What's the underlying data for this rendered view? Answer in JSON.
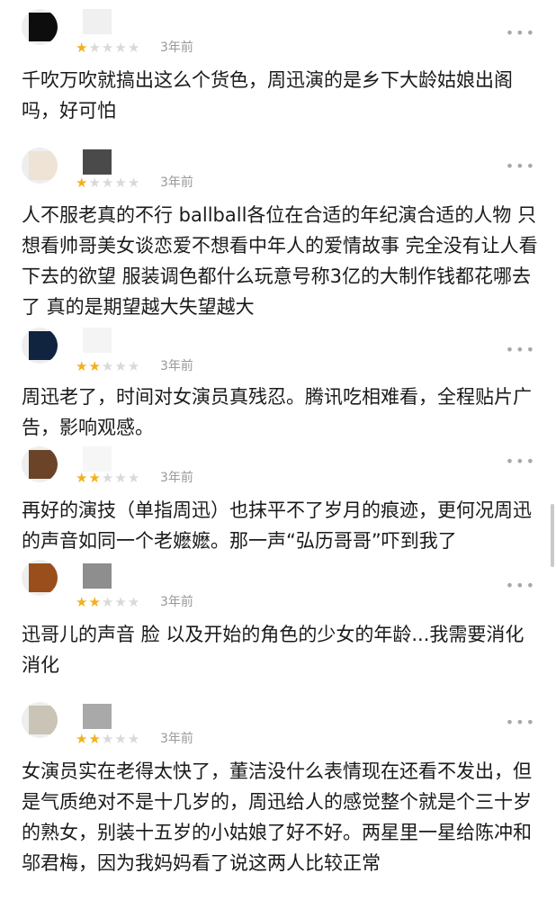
{
  "reviews": [
    {
      "stars": 1,
      "time": "3年前",
      "more": "•••",
      "text": "千吹万吹就搞出这么个货色，周迅演的是乡下大龄姑娘出阁吗，好可怕",
      "avatar_color": "#0d0d0d",
      "name_color": "#f0f0f0"
    },
    {
      "stars": 1,
      "time": "3年前",
      "more": "•••",
      "text": "人不服老真的不行 ballball各位在合适的年纪演合适的人物  只想看帅哥美女谈恋爱不想看中年人的爱情故事 完全没有让人看下去的欲望 服装调色都什么玩意号称3亿的大制作钱都花哪去了 真的是期望越大失望越大",
      "avatar_color": "#efe3d6",
      "name_color": "#4a4a4a"
    },
    {
      "stars": 2,
      "time": "3年前",
      "more": "•••",
      "text": "周迅老了，时间对女演员真残忍。腾讯吃相难看，全程贴片广告，影响观感。",
      "avatar_color": "#10233f",
      "name_color": "#f4f4f4"
    },
    {
      "stars": 2,
      "time": "3年前",
      "more": "•••",
      "text": "再好的演技（单指周迅）也抹平不了岁月的痕迹，更何况周迅的声音如同一个老嬷嬷。那一声“弘历哥哥”吓到我了",
      "avatar_color": "#6b4328",
      "name_color": "#f6f6f6"
    },
    {
      "stars": 2,
      "time": "3年前",
      "more": "•••",
      "text": "迅哥儿的声音 脸 以及开始的角色的少女的年龄...我需要消化消化",
      "avatar_color": "#9a4e1c",
      "name_color": "#8e8e8e"
    },
    {
      "stars": 2,
      "time": "3年前",
      "more": "•••",
      "text": "女演员实在老得太快了，董洁没什么表情现在还看不发出，但是气质绝对不是十几岁的，周迅给人的感觉整个就是个三十岁的熟女，别装十五岁的小姑娘了好不好。两星里一星给陈冲和邬君梅，因为我妈妈看了说这两人比较正常",
      "avatar_color": "#c9c4b5",
      "name_color": "#a9a9a9"
    }
  ],
  "colors": {
    "star_on": "#f2b01e",
    "star_off": "#d9d9d9",
    "time": "#9a9a9a"
  }
}
